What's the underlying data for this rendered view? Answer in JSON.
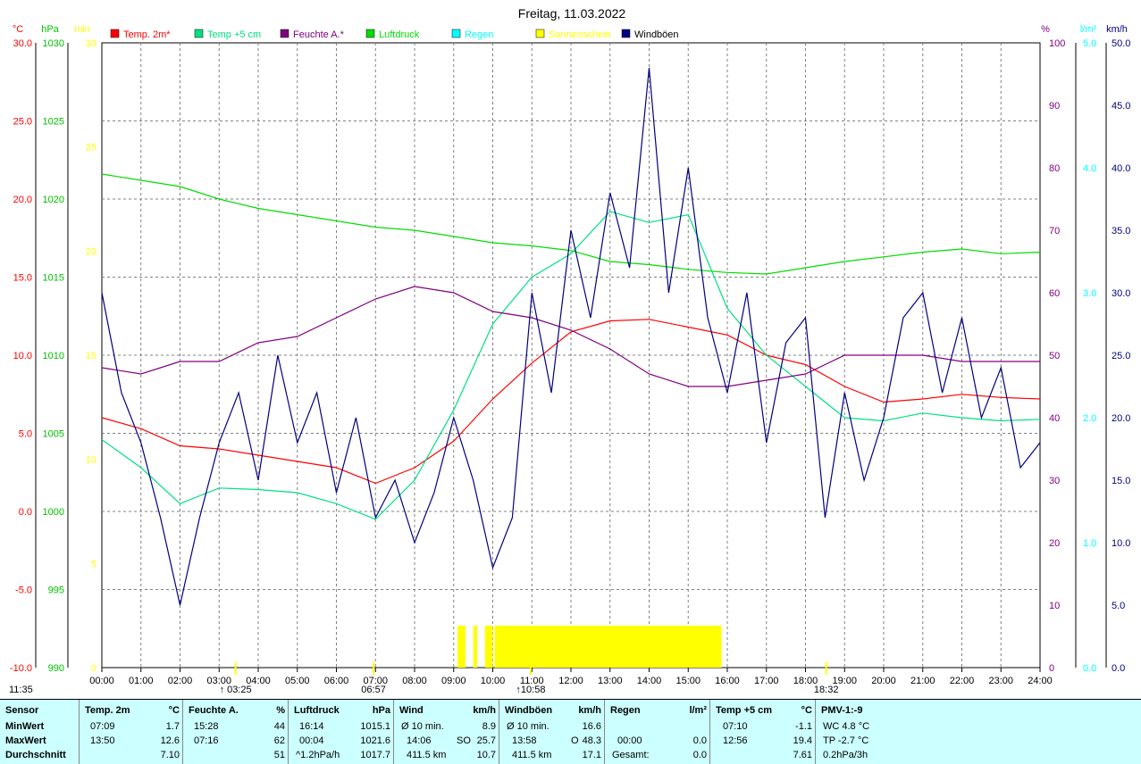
{
  "chart_data": {
    "type": "line",
    "title": "Freitag, 11.03.2022",
    "x_ticks": [
      "00:00",
      "01:00",
      "02:00",
      "03:00",
      "04:00",
      "05:00",
      "06:00",
      "07:00",
      "08:00",
      "09:00",
      "10:00",
      "11:00",
      "12:00",
      "13:00",
      "14:00",
      "15:00",
      "16:00",
      "17:00",
      "18:00",
      "19:00",
      "20:00",
      "21:00",
      "22:00",
      "23:00",
      "24:00"
    ],
    "left_axes": [
      {
        "unit": "°C",
        "color": "#ff0000",
        "ticks": [
          "30.0",
          "25.0",
          "20.0",
          "15.0",
          "10.0",
          "5.0",
          "0.0",
          "-5.0",
          "-10.0"
        ]
      },
      {
        "unit": "hPa",
        "color": "#00c000",
        "ticks": [
          "1030",
          "1025",
          "1020",
          "1015",
          "1010",
          "1005",
          "1000",
          "995",
          "990"
        ]
      },
      {
        "unit": "min",
        "color": "#ffff00",
        "ticks": [
          "30",
          "25",
          "20",
          "15",
          "10",
          "5",
          "0"
        ]
      }
    ],
    "right_axes": [
      {
        "unit": "%",
        "color": "#800080",
        "ticks": [
          "100",
          "90",
          "80",
          "70",
          "60",
          "50",
          "40",
          "30",
          "20",
          "10",
          "0"
        ]
      },
      {
        "unit": "l/m²",
        "color": "#00ffff",
        "ticks": [
          "5.0",
          "4.0",
          "3.0",
          "2.0",
          "1.0",
          "0.0"
        ]
      },
      {
        "unit": "km/h",
        "color": "#000080",
        "ticks": [
          "50.0",
          "45.0",
          "40.0",
          "35.0",
          "30.0",
          "25.0",
          "20.0",
          "15.0",
          "10.0",
          "5.0",
          "0.0"
        ]
      }
    ],
    "legend": [
      {
        "name": "Temp. 2m*",
        "color": "#ff0000"
      },
      {
        "name": "Temp +5 cm",
        "color": "#00e080"
      },
      {
        "name": "Feuchte A.*",
        "color": "#800080"
      },
      {
        "name": "Luftdruck",
        "color": "#00dd00"
      },
      {
        "name": "Regen",
        "color": "#00ffff"
      },
      {
        "name": "Sonnenschein",
        "color": "#ffff00"
      },
      {
        "name": "Windböen",
        "color": "#000080"
      }
    ],
    "series": [
      {
        "name": "Temp. 2m*",
        "color": "#ff0000",
        "axis": "°C",
        "points": [
          [
            0,
            6.0
          ],
          [
            1,
            5.3
          ],
          [
            2,
            4.2
          ],
          [
            3,
            4.0
          ],
          [
            4,
            3.6
          ],
          [
            5,
            3.2
          ],
          [
            6,
            2.8
          ],
          [
            7,
            1.8
          ],
          [
            8,
            2.8
          ],
          [
            9,
            4.5
          ],
          [
            10,
            7.2
          ],
          [
            11,
            9.5
          ],
          [
            12,
            11.5
          ],
          [
            13,
            12.2
          ],
          [
            14,
            12.3
          ],
          [
            15,
            11.8
          ],
          [
            16,
            11.3
          ],
          [
            17,
            10.0
          ],
          [
            18,
            9.4
          ],
          [
            19,
            8.0
          ],
          [
            20,
            7.0
          ],
          [
            21,
            7.2
          ],
          [
            22,
            7.5
          ],
          [
            23,
            7.3
          ],
          [
            24,
            7.2
          ]
        ]
      },
      {
        "name": "Temp +5 cm",
        "color": "#00e080",
        "axis": "°C",
        "points": [
          [
            0,
            4.6
          ],
          [
            1,
            2.8
          ],
          [
            2,
            0.5
          ],
          [
            3,
            1.5
          ],
          [
            4,
            1.4
          ],
          [
            5,
            1.2
          ],
          [
            6,
            0.5
          ],
          [
            7,
            -0.5
          ],
          [
            8,
            2.0
          ],
          [
            9,
            6.5
          ],
          [
            10,
            12.0
          ],
          [
            11,
            15.0
          ],
          [
            12,
            16.5
          ],
          [
            13,
            19.2
          ],
          [
            14,
            18.5
          ],
          [
            15,
            19.0
          ],
          [
            16,
            13.0
          ],
          [
            17,
            10.0
          ],
          [
            18,
            8.0
          ],
          [
            19,
            6.0
          ],
          [
            20,
            5.8
          ],
          [
            21,
            6.3
          ],
          [
            22,
            6.0
          ],
          [
            23,
            5.8
          ],
          [
            24,
            5.9
          ]
        ]
      },
      {
        "name": "Feuchte A.*",
        "color": "#800080",
        "axis": "%",
        "points": [
          [
            0,
            48
          ],
          [
            1,
            47
          ],
          [
            2,
            49
          ],
          [
            3,
            49
          ],
          [
            4,
            52
          ],
          [
            5,
            53
          ],
          [
            6,
            56
          ],
          [
            7,
            59
          ],
          [
            8,
            61
          ],
          [
            9,
            60
          ],
          [
            10,
            57
          ],
          [
            11,
            56
          ],
          [
            12,
            54
          ],
          [
            13,
            51
          ],
          [
            14,
            47
          ],
          [
            15,
            45
          ],
          [
            16,
            45
          ],
          [
            17,
            46
          ],
          [
            18,
            47
          ],
          [
            19,
            50
          ],
          [
            20,
            50
          ],
          [
            21,
            50
          ],
          [
            22,
            49
          ],
          [
            23,
            49
          ],
          [
            24,
            49
          ]
        ]
      },
      {
        "name": "Luftdruck",
        "color": "#00dd00",
        "axis": "hPa",
        "points": [
          [
            0,
            1021.6
          ],
          [
            1,
            1021.2
          ],
          [
            2,
            1020.8
          ],
          [
            3,
            1020.0
          ],
          [
            4,
            1019.4
          ],
          [
            5,
            1019.0
          ],
          [
            6,
            1018.6
          ],
          [
            7,
            1018.2
          ],
          [
            8,
            1018.0
          ],
          [
            9,
            1017.6
          ],
          [
            10,
            1017.2
          ],
          [
            11,
            1017.0
          ],
          [
            12,
            1016.7
          ],
          [
            13,
            1016.0
          ],
          [
            14,
            1015.8
          ],
          [
            15,
            1015.5
          ],
          [
            16,
            1015.3
          ],
          [
            17,
            1015.2
          ],
          [
            18,
            1015.6
          ],
          [
            19,
            1016.0
          ],
          [
            20,
            1016.3
          ],
          [
            21,
            1016.6
          ],
          [
            22,
            1016.8
          ],
          [
            23,
            1016.5
          ],
          [
            24,
            1016.6
          ]
        ]
      },
      {
        "name": "Windböen",
        "color": "#000080",
        "axis": "km/h",
        "points": [
          [
            0,
            30
          ],
          [
            0.5,
            22
          ],
          [
            1,
            18
          ],
          [
            1.5,
            12
          ],
          [
            2,
            5
          ],
          [
            2.5,
            12
          ],
          [
            3,
            18
          ],
          [
            3.5,
            22
          ],
          [
            4,
            15
          ],
          [
            4.5,
            25
          ],
          [
            5,
            18
          ],
          [
            5.5,
            22
          ],
          [
            6,
            14
          ],
          [
            6.5,
            20
          ],
          [
            7,
            12
          ],
          [
            7.5,
            15
          ],
          [
            8,
            10
          ],
          [
            8.5,
            14
          ],
          [
            9,
            20
          ],
          [
            9.5,
            15
          ],
          [
            10,
            8
          ],
          [
            10.5,
            12
          ],
          [
            11,
            30
          ],
          [
            11.5,
            22
          ],
          [
            12,
            35
          ],
          [
            12.5,
            28
          ],
          [
            13,
            38
          ],
          [
            13.5,
            32
          ],
          [
            14,
            48
          ],
          [
            14.5,
            30
          ],
          [
            15,
            40
          ],
          [
            15.5,
            28
          ],
          [
            16,
            22
          ],
          [
            16.5,
            30
          ],
          [
            17,
            18
          ],
          [
            17.5,
            26
          ],
          [
            18,
            28
          ],
          [
            18.5,
            12
          ],
          [
            19,
            22
          ],
          [
            19.5,
            15
          ],
          [
            20,
            20
          ],
          [
            20.5,
            28
          ],
          [
            21,
            30
          ],
          [
            21.5,
            22
          ],
          [
            22,
            28
          ],
          [
            22.5,
            20
          ],
          [
            23,
            24
          ],
          [
            23.5,
            16
          ],
          [
            24,
            18
          ]
        ]
      }
    ],
    "sun_bars": [
      [
        9.1,
        9.3
      ],
      [
        9.5,
        9.6
      ],
      [
        9.8,
        10.0
      ],
      [
        10.05,
        15.85
      ]
    ],
    "sun_markers": [
      {
        "x": 3.42,
        "label": "↑ 03:25"
      },
      {
        "x": 6.95,
        "label": "06:57"
      },
      {
        "x": 10.97,
        "label": "↑10:58"
      },
      {
        "x": 18.53,
        "label": "18:32"
      }
    ],
    "left_bottom_label": "11:35"
  },
  "table": {
    "sensor": {
      "header": "Sensor",
      "rows": [
        "MinWert",
        "MaxWert",
        "Durchschnitt"
      ]
    },
    "temp2m": {
      "header": "Temp. 2m",
      "unit": "°C",
      "times": [
        "07:09",
        "13:50",
        ""
      ],
      "values": [
        "1.7",
        "12.6",
        "7.10"
      ]
    },
    "feuchte": {
      "header": "Feuchte A.",
      "unit": "%",
      "times": [
        "15:28",
        "07:16",
        ""
      ],
      "values": [
        "44",
        "62",
        "51"
      ]
    },
    "luftdruck": {
      "header": "Luftdruck",
      "unit": "hPa",
      "times": [
        "16:14",
        "00:04",
        "^1.2hPa/h"
      ],
      "values": [
        "1015.1",
        "1021.6",
        "1017.7"
      ]
    },
    "wind": {
      "header": "Wind",
      "unit": "km/h",
      "c1": [
        "Ø 10 min.",
        "14:06",
        "411.5 km"
      ],
      "c2": [
        "",
        "SO",
        "",
        ""
      ],
      "values": [
        "8.9",
        "25.7",
        "10.7"
      ]
    },
    "windboeen": {
      "header": "Windböen",
      "unit": "km/h",
      "c1": [
        "Ø 10 min.",
        "13:58",
        "411.5 km"
      ],
      "c2": [
        "",
        "O",
        ""
      ],
      "values": [
        "16.6",
        "48.3",
        "17.1"
      ]
    },
    "regen": {
      "header": "Regen",
      "unit": "l/m²",
      "times": [
        "",
        "00:00",
        "Gesamt:"
      ],
      "values": [
        "",
        "0.0",
        "0.0"
      ]
    },
    "temp5": {
      "header": "Temp +5 cm",
      "unit": "°C",
      "times": [
        "07:10",
        "12:56",
        ""
      ],
      "values": [
        "-1.1",
        "19.4",
        "7.61"
      ]
    },
    "pmv": {
      "header": "PMV-1:-9",
      "rows": [
        "WC 4.8 °C",
        "TP -2.7 °C",
        "0.2hPa/3h"
      ]
    }
  }
}
